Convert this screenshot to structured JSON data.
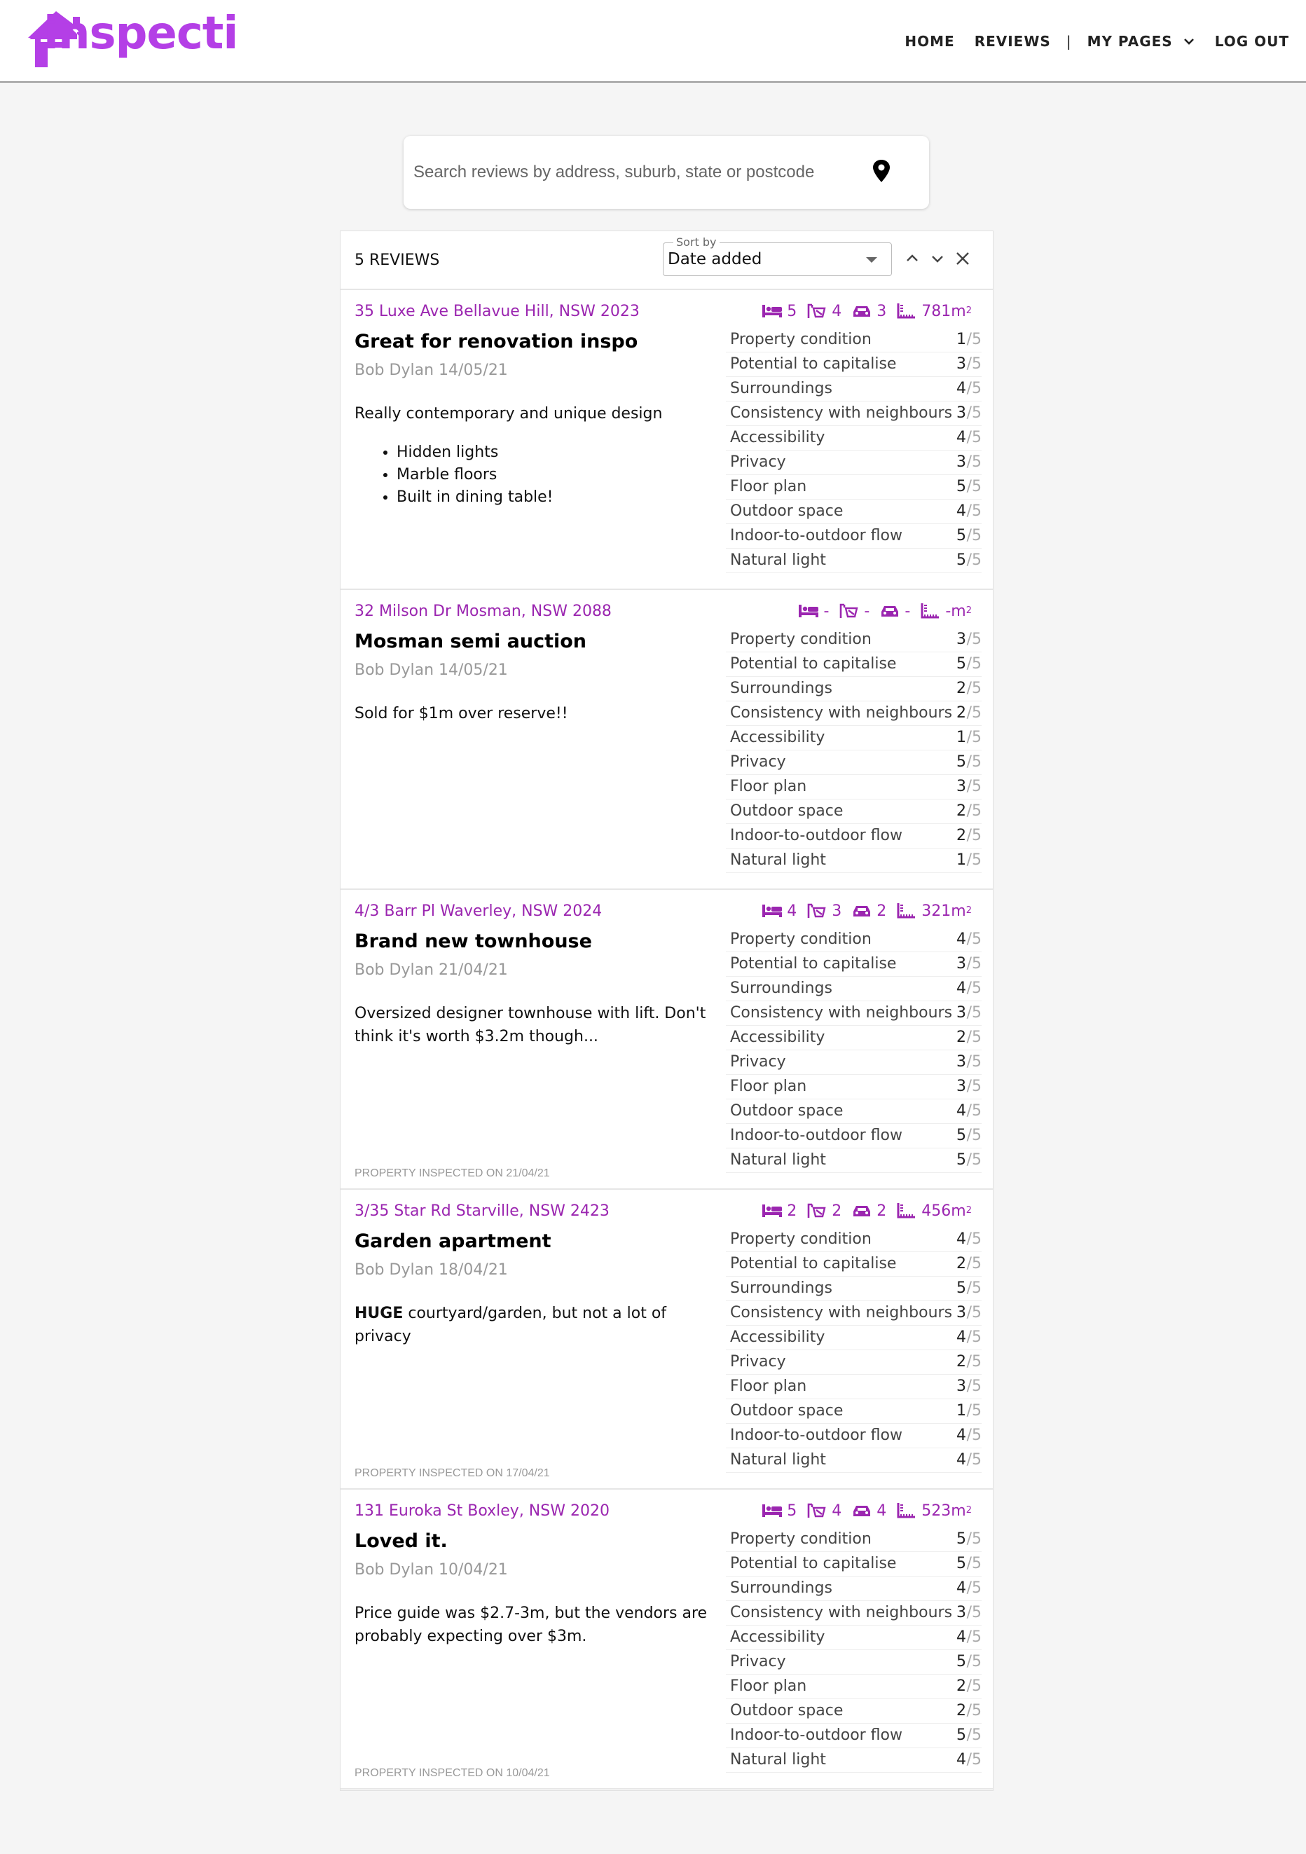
{
  "header": {
    "logo_text": "inspecti",
    "nav": {
      "home": "HOME",
      "reviews": "REVIEWS",
      "separator": "|",
      "my_pages": "MY PAGES",
      "log_out": "LOG OUT"
    }
  },
  "search": {
    "placeholder": "Search reviews by address, suburb, state or postcode",
    "value": ""
  },
  "results": {
    "count_label": "5 REVIEWS",
    "sort_label": "Sort by",
    "sort_value": "Date added"
  },
  "rating_max": "/5",
  "area_unit": "m",
  "area_sup": "2",
  "reviews": [
    {
      "address": "35 Luxe Ave Bellavue Hill, NSW 2023",
      "title": "Great for renovation inspo",
      "author": "Bob Dylan 14/05/21",
      "description": "Really contemporary and unique design",
      "bullets": [
        "Hidden lights",
        "Marble floors",
        "Built in dining table!"
      ],
      "inspected": "",
      "beds": "5",
      "baths": "4",
      "cars": "3",
      "area": "781",
      "ratings": [
        {
          "label": "Property condition",
          "value": "1"
        },
        {
          "label": "Potential to capitalise",
          "value": "3"
        },
        {
          "label": "Surroundings",
          "value": "4"
        },
        {
          "label": "Consistency with neighbours",
          "value": "3"
        },
        {
          "label": "Accessibility",
          "value": "4"
        },
        {
          "label": "Privacy",
          "value": "3"
        },
        {
          "label": "Floor plan",
          "value": "5"
        },
        {
          "label": "Outdoor space",
          "value": "4"
        },
        {
          "label": "Indoor-to-outdoor flow",
          "value": "5"
        },
        {
          "label": "Natural light",
          "value": "5"
        }
      ]
    },
    {
      "address": "32 Milson Dr Mosman, NSW 2088",
      "title": "Mosman semi auction",
      "author": "Bob Dylan 14/05/21",
      "description": "Sold for $1m over reserve!!",
      "bullets": [],
      "inspected": "",
      "beds": "-",
      "baths": "-",
      "cars": "-",
      "area": "-",
      "ratings": [
        {
          "label": "Property condition",
          "value": "3"
        },
        {
          "label": "Potential to capitalise",
          "value": "5"
        },
        {
          "label": "Surroundings",
          "value": "2"
        },
        {
          "label": "Consistency with neighbours",
          "value": "2"
        },
        {
          "label": "Accessibility",
          "value": "1"
        },
        {
          "label": "Privacy",
          "value": "5"
        },
        {
          "label": "Floor plan",
          "value": "3"
        },
        {
          "label": "Outdoor space",
          "value": "2"
        },
        {
          "label": "Indoor-to-outdoor flow",
          "value": "2"
        },
        {
          "label": "Natural light",
          "value": "1"
        }
      ]
    },
    {
      "address": "4/3 Barr Pl Waverley, NSW 2024",
      "title": "Brand new townhouse",
      "author": "Bob Dylan 21/04/21",
      "description": "Oversized designer townhouse with lift. Don't think it's worth $3.2m though...",
      "bullets": [],
      "inspected": "PROPERTY INSPECTED ON 21/04/21",
      "beds": "4",
      "baths": "3",
      "cars": "2",
      "area": "321",
      "ratings": [
        {
          "label": "Property condition",
          "value": "4"
        },
        {
          "label": "Potential to capitalise",
          "value": "3"
        },
        {
          "label": "Surroundings",
          "value": "4"
        },
        {
          "label": "Consistency with neighbours",
          "value": "3"
        },
        {
          "label": "Accessibility",
          "value": "2"
        },
        {
          "label": "Privacy",
          "value": "3"
        },
        {
          "label": "Floor plan",
          "value": "3"
        },
        {
          "label": "Outdoor space",
          "value": "4"
        },
        {
          "label": "Indoor-to-outdoor flow",
          "value": "5"
        },
        {
          "label": "Natural light",
          "value": "5"
        }
      ]
    },
    {
      "address": "3/35 Star Rd Starville, NSW 2423",
      "title": "Garden apartment",
      "author": "Bob Dylan 18/04/21",
      "description_bold": "HUGE",
      "description": " courtyard/garden, but not a lot of privacy",
      "bullets": [],
      "inspected": "PROPERTY INSPECTED ON 17/04/21",
      "beds": "2",
      "baths": "2",
      "cars": "2",
      "area": "456",
      "ratings": [
        {
          "label": "Property condition",
          "value": "4"
        },
        {
          "label": "Potential to capitalise",
          "value": "2"
        },
        {
          "label": "Surroundings",
          "value": "5"
        },
        {
          "label": "Consistency with neighbours",
          "value": "3"
        },
        {
          "label": "Accessibility",
          "value": "4"
        },
        {
          "label": "Privacy",
          "value": "2"
        },
        {
          "label": "Floor plan",
          "value": "3"
        },
        {
          "label": "Outdoor space",
          "value": "1"
        },
        {
          "label": "Indoor-to-outdoor flow",
          "value": "4"
        },
        {
          "label": "Natural light",
          "value": "4"
        }
      ]
    },
    {
      "address": "131 Euroka St Boxley, NSW 2020",
      "title": "Loved it.",
      "author": "Bob Dylan 10/04/21",
      "description": "Price guide was $2.7-3m, but the vendors are probably expecting over $3m.",
      "bullets": [],
      "inspected": "PROPERTY INSPECTED ON 10/04/21",
      "beds": "5",
      "baths": "4",
      "cars": "4",
      "area": "523",
      "ratings": [
        {
          "label": "Property condition",
          "value": "5"
        },
        {
          "label": "Potential to capitalise",
          "value": "5"
        },
        {
          "label": "Surroundings",
          "value": "4"
        },
        {
          "label": "Consistency with neighbours",
          "value": "3"
        },
        {
          "label": "Accessibility",
          "value": "4"
        },
        {
          "label": "Privacy",
          "value": "5"
        },
        {
          "label": "Floor plan",
          "value": "2"
        },
        {
          "label": "Outdoor space",
          "value": "2"
        },
        {
          "label": "Indoor-to-outdoor flow",
          "value": "5"
        },
        {
          "label": "Natural light",
          "value": "4"
        }
      ]
    }
  ],
  "colors": {
    "brand": "#b43fe6",
    "accent": "#9b26b0"
  },
  "icons": {
    "logo": "house-logo-icon",
    "search": "location-pin-icon",
    "bed": "bed-icon",
    "bath": "bath-icon",
    "car": "car-icon",
    "area": "area-icon"
  }
}
